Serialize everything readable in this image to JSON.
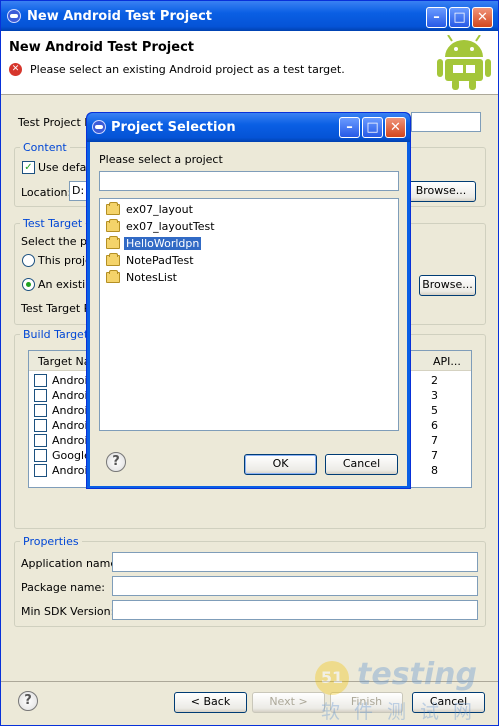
{
  "window": {
    "title": "New Android Test Project"
  },
  "banner": {
    "title": "New Android Test Project",
    "message": "Please select an existing Android project as a test target."
  },
  "project": {
    "name_label": "Test Project N"
  },
  "content": {
    "legend": "Content",
    "use_default": "Use defau",
    "location_label": "Location:",
    "location_value": "D:",
    "browse": "Browse..."
  },
  "test_target": {
    "legend": "Test Target",
    "select_label": "Select the pro",
    "this_project": "This projec",
    "existing": "An existing",
    "browse": "Browse...",
    "target_label": "Test Target P"
  },
  "build_target": {
    "legend": "Build Target",
    "col_target": "Target Nar",
    "col_api": "API...",
    "rows": [
      {
        "name": "Androic",
        "api": "2"
      },
      {
        "name": "Androic",
        "api": "3"
      },
      {
        "name": "Androic",
        "api": "5"
      },
      {
        "name": "Androic",
        "api": "6"
      },
      {
        "name": "Androic",
        "api": "7"
      },
      {
        "name": "Google",
        "api": "7"
      },
      {
        "name": "Androic",
        "api": "8"
      }
    ]
  },
  "properties": {
    "legend": "Properties",
    "app_name": "Application name:",
    "package_name": "Package name:",
    "min_sdk": "Min SDK Version:"
  },
  "footer": {
    "back": "< Back",
    "next": "Next >",
    "finish": "Finish",
    "cancel": "Cancel"
  },
  "dialog": {
    "title": "Project Selection",
    "prompt": "Please select a project",
    "filter_value": "",
    "projects": [
      "ex07_layout",
      "ex07_layoutTest",
      "HelloWorldpn",
      "NotePadTest",
      "NotesList"
    ],
    "selected": "HelloWorldpn",
    "ok": "OK",
    "cancel": "Cancel"
  },
  "watermark": {
    "brand": "testing",
    "cn": "软件测试网",
    "num": "51"
  },
  "colors": {
    "accent": "#0a5fe4",
    "selection": "#316ac5",
    "android_green": "#a4c639"
  }
}
